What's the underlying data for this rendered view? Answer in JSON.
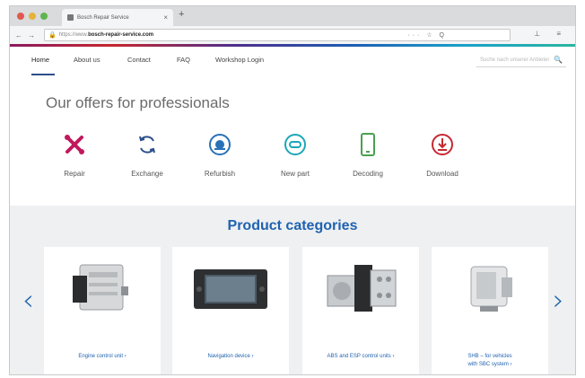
{
  "browser": {
    "tab_title": "Bosch Repair Service",
    "tab_close": "×",
    "new_tab": "+",
    "url_prefix": "https://www.",
    "url_host": "bosch-repair-service.com",
    "url_tools": "··· ☆ Q",
    "nav_back": "←",
    "nav_forward": "→",
    "nav_reload": "C",
    "nav_right": "⊥ ≡"
  },
  "site_nav": {
    "items": [
      "Home",
      "About us",
      "Contact",
      "FAQ",
      "Workshop Login"
    ],
    "search_placeholder": "Suche nach unserer Anbieter"
  },
  "offers": {
    "title": "Our offers for professionals",
    "items": [
      {
        "label": "Repair",
        "icon": "repair-icon",
        "color": "#c0185c"
      },
      {
        "label": "Exchange",
        "icon": "exchange-icon",
        "color": "#2c4f8a"
      },
      {
        "label": "Refurbish",
        "icon": "refurbish-icon",
        "color": "#2872b8"
      },
      {
        "label": "New part",
        "icon": "new-part-icon",
        "color": "#1ba7b8"
      },
      {
        "label": "Decoding",
        "icon": "decoding-icon",
        "color": "#4aa04f"
      },
      {
        "label": "Download",
        "icon": "download-icon",
        "color": "#c62832"
      }
    ]
  },
  "categories": {
    "title": "Product categories",
    "prev": "‹",
    "next": "›",
    "cards": [
      {
        "label": "Engine control unit ›"
      },
      {
        "label": "Navigation device ›"
      },
      {
        "label": "ABS and ESP control units ›"
      },
      {
        "label_line1": "SHB – for vehicles",
        "label_line2": "with SBC system ›"
      }
    ]
  },
  "colors": {
    "accent": "#1f62b0",
    "nav_underline": "#2c4f8a",
    "section_bg": "#eef0f1"
  }
}
